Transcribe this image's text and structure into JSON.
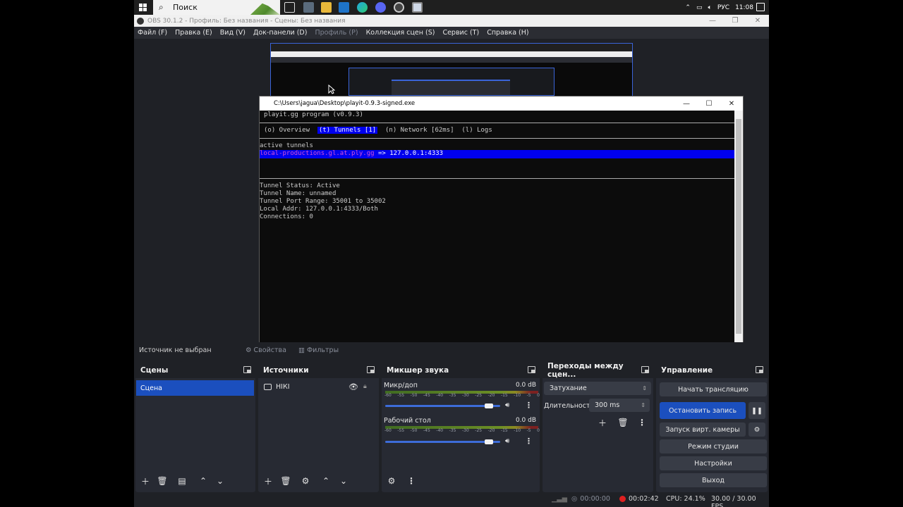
{
  "taskbar": {
    "search_label": "Поиск",
    "tray_lang": "РУС",
    "tray_time": "11:08",
    "apps": [
      "task-view-icon",
      "calculator-icon",
      "file-explorer-icon",
      "mail-icon",
      "edge-icon",
      "discord-icon",
      "obs-icon",
      "terminal-icon"
    ]
  },
  "obs": {
    "window_title": "OBS 30.1.2 - Профиль: Без названия - Сцены: Без названия",
    "menu": [
      "Файл (F)",
      "Правка (E)",
      "Вид (V)",
      "Док-панели (D)",
      "Профиль (P)",
      "Коллекция сцен (S)",
      "Сервис (T)",
      "Справка (H)"
    ]
  },
  "console": {
    "title": "C:\\Users\\jagua\\Desktop\\playit-0.9.3-signed.exe",
    "header": "playit.gg program (v0.9.3)",
    "tabs": {
      "overview": "(o) Overview",
      "tunnels": "(t) Tunnels [1]",
      "network": "(n) Network [62ms]",
      "logs": "(l) Logs"
    },
    "active_tunnels_label": "active tunnels",
    "tunnel_host": "local-productions.gl.at.ply.gg",
    "tunnel_target": " => 127.0.0.1:4333",
    "details": [
      "Tunnel Status: Active",
      "Tunnel Name: unnamed",
      "Tunnel Port Range: 35001 to 35002",
      "Local Addr: 127.0.0.1:4333/Both",
      "Connections: 0"
    ]
  },
  "source_bar": {
    "no_source": "Источник не выбран",
    "properties": "Свойства",
    "filters": "Фильтры"
  },
  "scenes": {
    "title": "Сцены",
    "items": [
      "Сцена"
    ]
  },
  "sources": {
    "title": "Источники",
    "items": [
      "НIКI"
    ]
  },
  "mixer": {
    "title": "Микшер звука",
    "ticks": [
      "-60",
      "-55",
      "-50",
      "-45",
      "-40",
      "-35",
      "-30",
      "-25",
      "-20",
      "-15",
      "-10",
      "-5",
      "0"
    ],
    "channels": [
      {
        "name": "Микр/доп",
        "level": "0.0 dB",
        "volume": 0.9
      },
      {
        "name": "Рабочий стол",
        "level": "0.0 dB",
        "volume": 0.9
      }
    ]
  },
  "transitions": {
    "title": "Переходы между сцен...",
    "selected": "Затухание",
    "duration_label": "Длительность",
    "duration_value": "300 ms"
  },
  "controls": {
    "title": "Управление",
    "start_stream": "Начать трансляцию",
    "stop_record": "Остановить запись",
    "virtual_cam": "Запуск вирт. камеры",
    "studio_mode": "Режим студии",
    "settings": "Настройки",
    "exit": "Выход"
  },
  "status": {
    "stream_time": "00:00:00",
    "record_time": "00:02:42",
    "cpu": "CPU: 24.1%",
    "fps": "30.00 / 30.00 FPS"
  },
  "colors": {
    "accent": "#1b4fbe",
    "record": "#e02020"
  }
}
